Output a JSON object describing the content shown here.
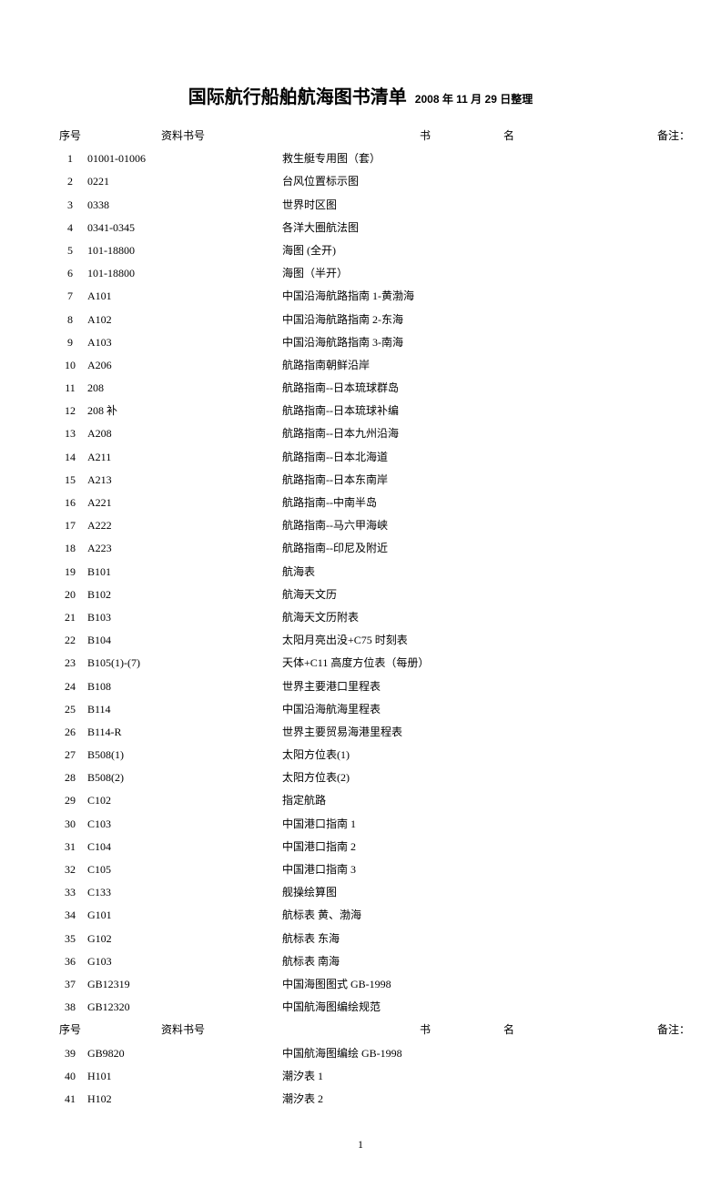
{
  "title": "国际航行船舶航海图书清单",
  "subtitle": "2008 年 11 月 29 日整理",
  "headers": {
    "seq": "序号",
    "code": "资料书号",
    "name": "书名",
    "name_c1": "书",
    "name_c2": "名",
    "note": "备注："
  },
  "rows1": [
    {
      "seq": "1",
      "code": "01001-01006",
      "name": "救生艇专用图（套）",
      "note": ""
    },
    {
      "seq": "2",
      "code": "0221",
      "name": "台风位置标示图",
      "note": ""
    },
    {
      "seq": "3",
      "code": "0338",
      "name": "世界时区图",
      "note": ""
    },
    {
      "seq": "4",
      "code": "0341-0345",
      "name": "各洋大圈航法图",
      "note": ""
    },
    {
      "seq": "5",
      "code": "101-18800",
      "name": "海图 (全开)",
      "note": ""
    },
    {
      "seq": "6",
      "code": "101-18800",
      "name": "海图（半开）",
      "note": ""
    },
    {
      "seq": "7",
      "code": "A101",
      "name": "中国沿海航路指南 1-黄渤海",
      "note": ""
    },
    {
      "seq": "8",
      "code": "A102",
      "name": "中国沿海航路指南 2-东海",
      "note": ""
    },
    {
      "seq": "9",
      "code": "A103",
      "name": "中国沿海航路指南 3-南海",
      "note": ""
    },
    {
      "seq": "10",
      "code": "A206",
      "name": "航路指南朝鲜沿岸",
      "note": ""
    },
    {
      "seq": "11",
      "code": "208",
      "name": "航路指南--日本琉球群岛",
      "note": ""
    },
    {
      "seq": "12",
      "code": "208 补",
      "name": "航路指南--日本琉球补编",
      "note": ""
    },
    {
      "seq": "13",
      "code": "A208",
      "name": "航路指南--日本九州沿海",
      "note": ""
    },
    {
      "seq": "14",
      "code": "A211",
      "name": "航路指南--日本北海道",
      "note": ""
    },
    {
      "seq": "15",
      "code": "A213",
      "name": "航路指南--日本东南岸",
      "note": ""
    },
    {
      "seq": "16",
      "code": "A221",
      "name": "航路指南--中南半岛",
      "note": ""
    },
    {
      "seq": "17",
      "code": "A222",
      "name": "航路指南--马六甲海峡",
      "note": ""
    },
    {
      "seq": "18",
      "code": "A223",
      "name": "航路指南--印尼及附近",
      "note": ""
    },
    {
      "seq": "19",
      "code": "B101",
      "name": "航海表",
      "note": ""
    },
    {
      "seq": "20",
      "code": "B102",
      "name": "航海天文历",
      "note": ""
    },
    {
      "seq": "21",
      "code": "B103",
      "name": "航海天文历附表",
      "note": ""
    },
    {
      "seq": "22",
      "code": "B104",
      "name": "太阳月亮出没+C75 时刻表",
      "note": ""
    },
    {
      "seq": "23",
      "code": "B105(1)-(7)",
      "name": "天体+C11 高度方位表（每册）",
      "note": ""
    },
    {
      "seq": "24",
      "code": "B108",
      "name": "世界主要港口里程表",
      "note": ""
    },
    {
      "seq": "25",
      "code": "B114",
      "name": "中国沿海航海里程表",
      "note": ""
    },
    {
      "seq": "26",
      "code": "B114-R",
      "name": "世界主要贸易海港里程表",
      "note": ""
    },
    {
      "seq": "27",
      "code": "B508(1)",
      "name": "太阳方位表(1)",
      "note": ""
    },
    {
      "seq": "28",
      "code": "B508(2)",
      "name": "太阳方位表(2)",
      "note": ""
    },
    {
      "seq": "29",
      "code": "C102",
      "name": "指定航路",
      "note": ""
    },
    {
      "seq": "30",
      "code": "C103",
      "name": "中国港口指南 1",
      "note": ""
    },
    {
      "seq": "31",
      "code": "C104",
      "name": "中国港口指南 2",
      "note": ""
    },
    {
      "seq": "32",
      "code": "C105",
      "name": "中国港口指南 3",
      "note": ""
    },
    {
      "seq": "33",
      "code": "C133",
      "name": "舰操绘算图",
      "note": ""
    },
    {
      "seq": "34",
      "code": "G101",
      "name": "航标表 黄、渤海",
      "note": ""
    },
    {
      "seq": "35",
      "code": "G102",
      "name": "航标表 东海",
      "note": ""
    },
    {
      "seq": "36",
      "code": "G103",
      "name": "航标表 南海",
      "note": ""
    },
    {
      "seq": "37",
      "code": "GB12319",
      "name": "中国海图图式 GB-1998",
      "note": ""
    },
    {
      "seq": "38",
      "code": "GB12320",
      "name": "中国航海图编绘规范",
      "note": ""
    }
  ],
  "rows2": [
    {
      "seq": "39",
      "code": "GB9820",
      "name": "中国航海图编绘 GB-1998",
      "note": ""
    },
    {
      "seq": "40",
      "code": "H101",
      "name": "潮汐表 1",
      "note": ""
    },
    {
      "seq": "41",
      "code": "H102",
      "name": "潮汐表 2",
      "note": ""
    }
  ],
  "page_number": "1"
}
